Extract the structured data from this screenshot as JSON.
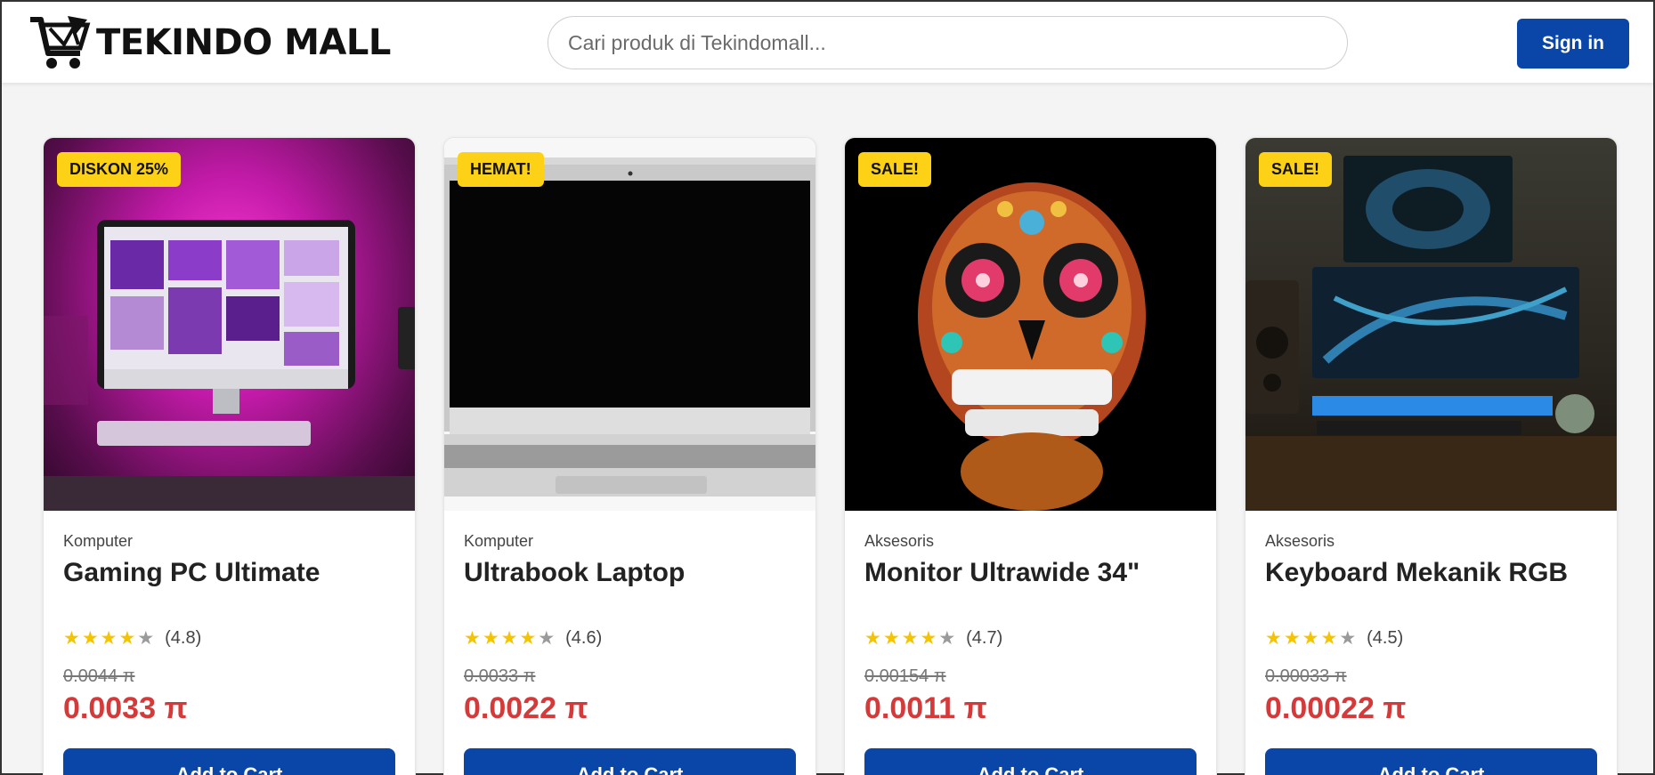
{
  "header": {
    "logo_text": "TEKINDO MALL",
    "logo_icon": "shopping-cart-icon",
    "search_placeholder": "Cari produk di Tekindomall...",
    "signin_label": "Sign in"
  },
  "colors": {
    "primary": "#0a45a8",
    "badge": "#fcd116",
    "price": "#d43a3a",
    "star": "#f5c400"
  },
  "products": [
    {
      "badge": "DISKON 25%",
      "category": "Komputer",
      "name": "Gaming PC Ultimate",
      "stars_filled": 4,
      "rating": "(4.8)",
      "old_price": "0.0044 π",
      "price": "0.0033 π",
      "cart_label": "Add to Cart"
    },
    {
      "badge": "HEMAT!",
      "category": "Komputer",
      "name": "Ultrabook Laptop",
      "stars_filled": 4,
      "rating": "(4.6)",
      "old_price": "0.0033 π",
      "price": "0.0022 π",
      "cart_label": "Add to Cart"
    },
    {
      "badge": "SALE!",
      "category": "Aksesoris",
      "name": "Monitor Ultrawide 34\"",
      "stars_filled": 4,
      "rating": "(4.7)",
      "old_price": "0.00154 π",
      "price": "0.0011 π",
      "cart_label": "Add to Cart"
    },
    {
      "badge": "SALE!",
      "category": "Aksesoris",
      "name": "Keyboard Mekanik RGB",
      "stars_filled": 4,
      "rating": "(4.5)",
      "old_price": "0.00033 π",
      "price": "0.00022 π",
      "cart_label": "Add to Cart"
    }
  ]
}
